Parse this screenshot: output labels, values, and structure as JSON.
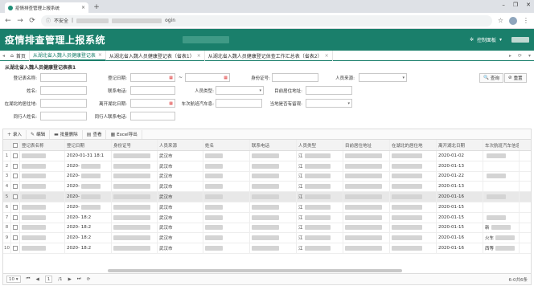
{
  "browser": {
    "tab_title": "疫情排查管理上报系统",
    "new_tab": "+",
    "close": "×",
    "security": "不安全",
    "url_fragment": "ogin",
    "window_controls": [
      "–",
      "❐",
      "✕"
    ]
  },
  "header": {
    "app_title": "疫情排查管理上报系统",
    "control_panel": "控制面板",
    "caret": "▾"
  },
  "page_tabs": {
    "home": "首页",
    "tabs": [
      {
        "label": "从湖北省入魏人员健康登记表",
        "active": true
      },
      {
        "label": "从湖北省入魏人员健康登记表（省表1）",
        "active": false
      },
      {
        "label": "从湖北省入魏人员健康登记体查工作汇总表（省表2）",
        "active": false
      }
    ]
  },
  "section_title": "从湖北省入魏人员健康登记表表1",
  "form": {
    "labels": {
      "registrant": "登记表名称:",
      "reg_date": "登记日期:",
      "id_no": "身份证号:",
      "person_source": "人员来源:",
      "name": "姓名:",
      "phone": "联系电话:",
      "person_type": "人员类型:",
      "current_address": "目前居住地址:",
      "hubei_address": "在湖北的居住地:",
      "leave_date": "离开湖北日期:",
      "vehicle": "车次航班汽车息:",
      "fever_check": "当地是否有留观:",
      "companions": "同行人姓名:",
      "contacts": "同行人联系电话:"
    },
    "tilde": "~",
    "query_button": "查询",
    "reset_button": "重置"
  },
  "toolbar": {
    "add": "录入",
    "edit": "编辑",
    "batch_delete": "批量删除",
    "view": "查看",
    "export": "Excel导出"
  },
  "table": {
    "columns": [
      "登记表名称",
      "登记日期",
      "身份证号",
      "人员来源",
      "姓名",
      "联系电话",
      "人员类型",
      "目前居住地址",
      "在湖北的居住地",
      "离开湖北日期",
      "车次航班汽车信息"
    ],
    "rows": [
      {
        "n": "1",
        "date": "2020-01-31 18:1",
        "source": "武汉市",
        "type": "江",
        "leave": "2020-01-02",
        "extra": ""
      },
      {
        "n": "2",
        "date": "2020-",
        "source": "武汉市",
        "type": "江",
        "leave": "2020-01-13",
        "extra": ""
      },
      {
        "n": "3",
        "date": "2020-",
        "source": "武汉市",
        "type": "江",
        "leave": "2020-01-22",
        "extra": ""
      },
      {
        "n": "4",
        "date": "2020-",
        "source": "武汉市",
        "type": "江",
        "leave": "2020-01-13",
        "extra": ""
      },
      {
        "n": "5",
        "date": "2020-",
        "source": "武汉市",
        "type": "江",
        "leave": "2020-01-16",
        "extra": ""
      },
      {
        "n": "6",
        "date": "2020-",
        "source": "武汉市",
        "type": "江",
        "leave": "2020-01-15",
        "extra": ""
      },
      {
        "n": "7",
        "date": "2020-    18:2",
        "source": "武汉市",
        "type": "江",
        "leave": "2020-01-15",
        "extra": ""
      },
      {
        "n": "8",
        "date": "2020-    18:2",
        "source": "武汉市",
        "type": "江",
        "leave": "2020-01-15",
        "extra": "新"
      },
      {
        "n": "9",
        "date": "2020-    18:2",
        "source": "武汉市",
        "type": "江",
        "leave": "2020-01-16",
        "extra": "火车"
      },
      {
        "n": "10",
        "date": "2020-    18:2",
        "source": "武汉市",
        "type": "江",
        "leave": "2020-01-16",
        "extra": "西等"
      }
    ]
  },
  "pager": {
    "page_size": "10",
    "page_size_caret": "▾",
    "current_page": "1",
    "total_pages": "/1",
    "info": "6-0共6条"
  }
}
